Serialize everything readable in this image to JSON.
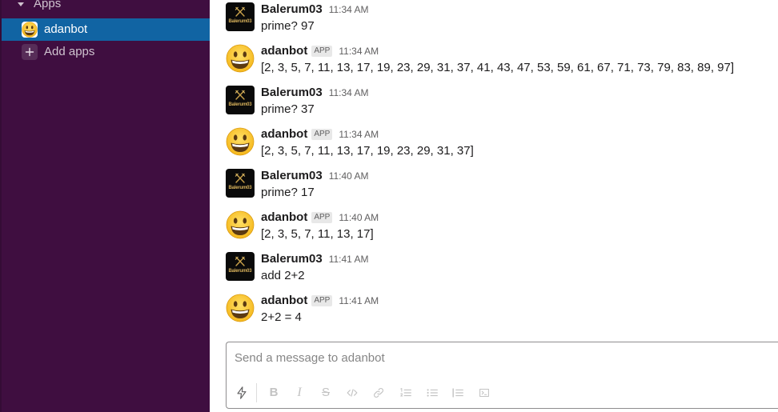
{
  "sidebar": {
    "section": {
      "toggle_icon": "caret-down-icon",
      "title": "Apps"
    },
    "items": [
      {
        "label": "adanbot",
        "icon": "grinning-face-icon",
        "active": true
      }
    ],
    "add_apps": {
      "icon": "plus-icon",
      "label": "Add apps"
    }
  },
  "messages": [
    {
      "sender": "Balerum03",
      "avatar": "balerum03-logo-avatar",
      "avatar_text": "Balerum03",
      "time": "11:34 AM",
      "text": "prime? 97"
    },
    {
      "sender": "adanbot",
      "avatar": "grinning-face-icon",
      "badge": "APP",
      "time": "11:34 AM",
      "text": "[2, 3, 5, 7, 11, 13, 17, 19, 23, 29, 31, 37, 41, 43, 47, 53, 59, 61, 67, 71, 73, 79, 83, 89, 97]"
    },
    {
      "sender": "Balerum03",
      "avatar": "balerum03-logo-avatar",
      "avatar_text": "Balerum03",
      "time": "11:34 AM",
      "text": "prime? 37"
    },
    {
      "sender": "adanbot",
      "avatar": "grinning-face-icon",
      "badge": "APP",
      "time": "11:34 AM",
      "text": "[2, 3, 5, 7, 11, 13, 17, 19, 23, 29, 31, 37]"
    },
    {
      "sender": "Balerum03",
      "avatar": "balerum03-logo-avatar",
      "avatar_text": "Balerum03",
      "time": "11:40 AM",
      "text": "prime? 17"
    },
    {
      "sender": "adanbot",
      "avatar": "grinning-face-icon",
      "badge": "APP",
      "time": "11:40 AM",
      "text": "[2, 3, 5, 7, 11, 13, 17]"
    },
    {
      "sender": "Balerum03",
      "avatar": "balerum03-logo-avatar",
      "avatar_text": "Balerum03",
      "time": "11:41 AM",
      "text": "add 2+2"
    },
    {
      "sender": "adanbot",
      "avatar": "grinning-face-icon",
      "badge": "APP",
      "time": "11:41 AM",
      "text": "2+2 = 4"
    }
  ],
  "composer": {
    "placeholder": "Send a message to adanbot",
    "toolbar": [
      {
        "icon": "lightning-icon"
      },
      {
        "icon": "bold-icon",
        "glyph": "B"
      },
      {
        "icon": "italic-icon",
        "glyph": "I"
      },
      {
        "icon": "strikethrough-icon",
        "glyph": "S"
      },
      {
        "icon": "code-icon"
      },
      {
        "icon": "link-icon"
      },
      {
        "icon": "ordered-list-icon"
      },
      {
        "icon": "bulleted-list-icon"
      },
      {
        "icon": "blockquote-icon"
      },
      {
        "icon": "code-block-icon"
      }
    ]
  },
  "colors": {
    "sidebar_bg": "#3f0e40",
    "active_item_bg": "#1164a3",
    "sidebar_text": "#cfc3cf",
    "text_primary": "#1d1c1d",
    "text_secondary": "#616061",
    "badge_bg": "#e8e8e8",
    "composer_border": "#8e8d8e",
    "toolbar_icon": "#c3c3c3"
  }
}
